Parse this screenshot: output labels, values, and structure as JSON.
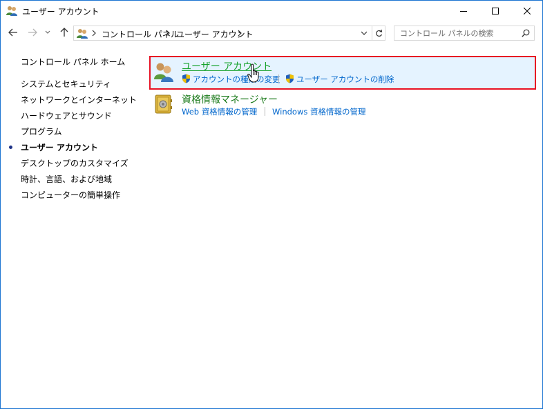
{
  "window": {
    "title": "ユーザー アカウント",
    "controls": {
      "minimize": "minimize",
      "maximize": "maximize",
      "close": "close"
    }
  },
  "address_bar": {
    "breadcrumbs": [
      "コントロール パネル",
      "ユーザー アカウント"
    ]
  },
  "search": {
    "placeholder": "コントロール パネルの検索"
  },
  "left_nav": {
    "home": "コントロール パネル ホーム",
    "items": [
      {
        "label": "システムとセキュリティ",
        "current": false
      },
      {
        "label": "ネットワークとインターネット",
        "current": false
      },
      {
        "label": "ハードウェアとサウンド",
        "current": false
      },
      {
        "label": "プログラム",
        "current": false
      },
      {
        "label": "ユーザー アカウント",
        "current": true
      },
      {
        "label": "デスクトップのカスタマイズ",
        "current": false
      },
      {
        "label": "時計、言語、および地域",
        "current": false
      },
      {
        "label": "コンピューターの簡単操作",
        "current": false
      }
    ]
  },
  "categories": [
    {
      "title": "ユーザー アカウント",
      "tasks": [
        "アカウントの種類の変更",
        "ユーザー アカウントの削除"
      ]
    },
    {
      "title": "資格情報マネージャー",
      "tasks": [
        "Web 資格情報の管理",
        "Windows 資格情報の管理"
      ]
    }
  ],
  "colors": {
    "highlight_border": "#e81123",
    "highlight_bg": "#e5f3ff",
    "link": "#0066cc",
    "category_title": "#1a7a1a"
  }
}
